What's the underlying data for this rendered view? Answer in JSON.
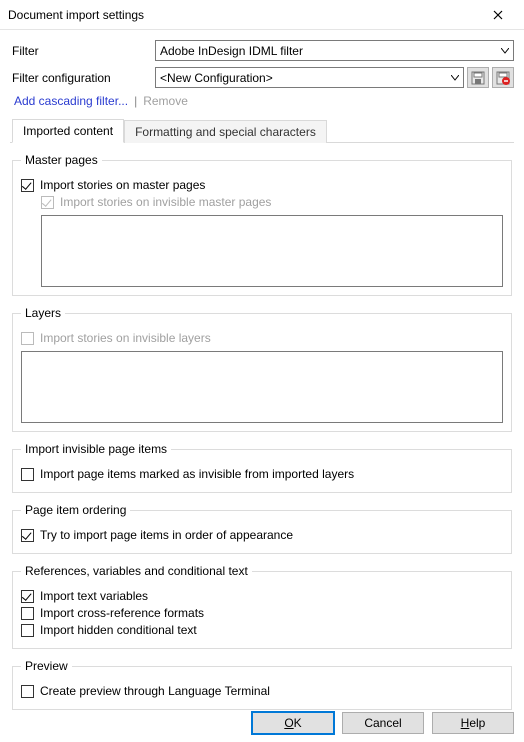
{
  "window": {
    "title": "Document import settings"
  },
  "filter": {
    "label": "Filter",
    "value": "Adobe InDesign IDML filter"
  },
  "config": {
    "label": "Filter configuration",
    "value": "<New Configuration>"
  },
  "links": {
    "add_cascading": "Add cascading filter...",
    "remove": "Remove"
  },
  "tabs": {
    "imported": "Imported content",
    "formatting": "Formatting and special characters"
  },
  "groups": {
    "master_pages": {
      "legend": "Master pages",
      "import_master": "Import stories on master pages",
      "import_invisible_master": "Import stories on invisible master pages"
    },
    "layers": {
      "legend": "Layers",
      "import_invisible_layers": "Import stories on invisible layers"
    },
    "invisible_items": {
      "legend": "Import invisible page items",
      "import_marked_invisible": "Import page items marked as invisible from imported layers"
    },
    "ordering": {
      "legend": "Page item ordering",
      "try_order": "Try to import page items in order of appearance"
    },
    "references": {
      "legend": "References, variables and conditional text",
      "text_vars": "Import text variables",
      "xref": "Import cross-reference formats",
      "hidden_cond": "Import hidden conditional text"
    },
    "preview": {
      "legend": "Preview",
      "create_preview": "Create preview through Language Terminal"
    }
  },
  "buttons": {
    "ok": "OK",
    "cancel": "Cancel",
    "help": "Help"
  }
}
